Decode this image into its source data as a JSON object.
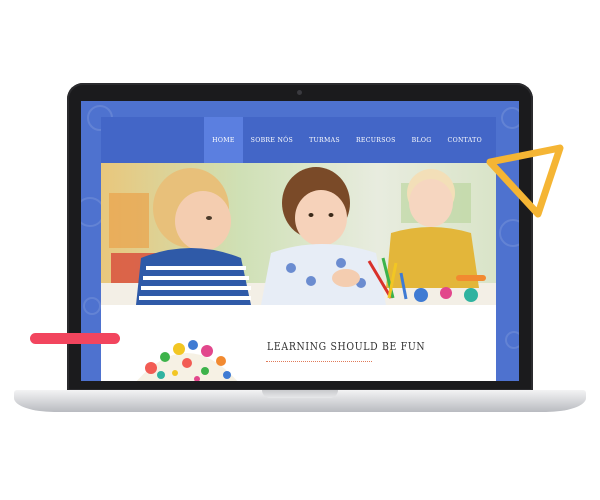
{
  "nav": {
    "items": [
      "HOME",
      "SOBRE NÓS",
      "TURMAS",
      "RECURSOS",
      "BLOG",
      "CONTATO"
    ],
    "active": "HOME"
  },
  "hero": {
    "image": "photo of three toddlers playing with colorful toys at a table"
  },
  "content": {
    "heading": "LEARNING SHOULD BE FUN",
    "illustration": "colorful cartoon doodles of children and toys"
  },
  "colors": {
    "screen_bg": "#4e72cf",
    "nav_bg": "#4366c7",
    "nav_active_bg": "#5b7fe0",
    "accent_red": "#f2455e",
    "accent_yellow": "#f5b534",
    "divider": "#e07a5a"
  }
}
